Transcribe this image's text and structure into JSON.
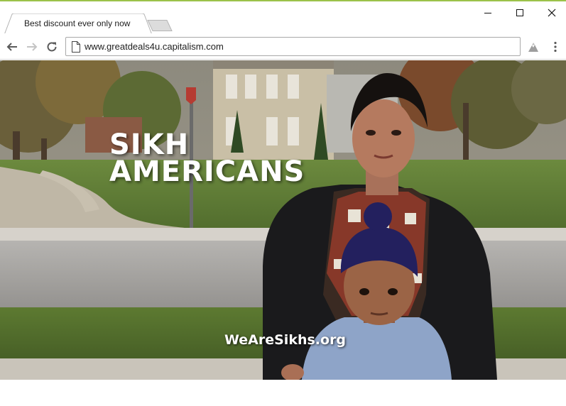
{
  "browser": {
    "tab": {
      "title": "Best discount ever only now"
    },
    "window_controls": {
      "minimize": "minimize-icon",
      "maximize": "maximize-icon",
      "close": "close-icon"
    },
    "toolbar": {
      "back_icon": "back-arrow-icon",
      "forward_icon": "forward-arrow-icon",
      "reload_icon": "reload-icon",
      "page_icon": "page-icon",
      "extension_icon": "cloud-extension-icon",
      "menu_icon": "kebab-menu-icon"
    },
    "address_bar": {
      "url": "www.greatdeals4u.capitalism.com"
    }
  },
  "content": {
    "headline": {
      "line1": "SIKH",
      "line2": "AMERICANS"
    },
    "watermark": "WeAreSikhs.org"
  },
  "colors": {
    "accent": "#9bc24a",
    "tab_border": "#b9b9b9",
    "omnibox_border": "#a9a9a9",
    "text": "#202020"
  }
}
